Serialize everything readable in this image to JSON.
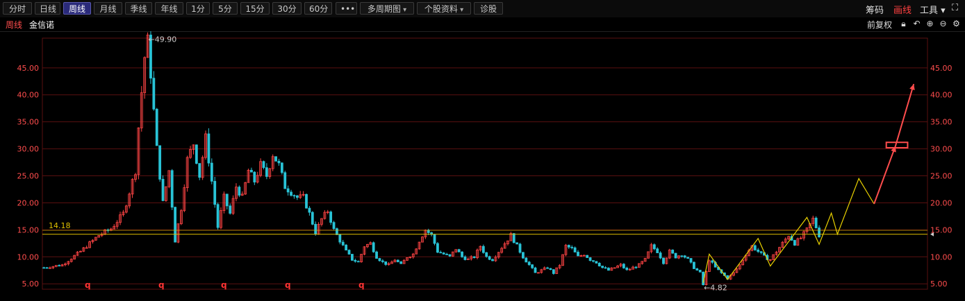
{
  "toolbar": {
    "buttons": [
      "分时",
      "日线",
      "周线",
      "月线",
      "季线",
      "年线",
      "1分",
      "5分",
      "15分",
      "30分",
      "60分",
      "•••",
      "多周期图",
      "个股资料",
      "诊股"
    ],
    "active_index": 2,
    "right_items": [
      "筹码",
      "画线",
      "工具"
    ]
  },
  "info": {
    "period": "周线",
    "stock_name": "金信诺",
    "adjust": "前复权"
  },
  "chart_data": {
    "type": "candlestick",
    "ylim": [
      4.0,
      50.5
    ],
    "y_ticks": [
      5.0,
      10.0,
      15.0,
      20.0,
      25.0,
      30.0,
      35.0,
      40.0,
      45.0
    ],
    "y_tick_labels": [
      "5.00",
      "10.00",
      "15.00",
      "20.00",
      "25.00",
      "30.00",
      "35.00",
      "40.00",
      "45.00"
    ],
    "high_label": "49.90",
    "low_label": "4.82",
    "level_label": "14.18",
    "level_value": 14.18,
    "level_value2": 14.9,
    "markers": [
      "q",
      "q",
      "q",
      "q",
      "q"
    ],
    "price_path": [
      [
        0,
        8.0
      ],
      [
        6,
        8.5
      ],
      [
        12,
        11
      ],
      [
        18,
        14
      ],
      [
        22,
        15.2
      ],
      [
        26,
        18
      ],
      [
        28,
        22
      ],
      [
        30,
        26
      ],
      [
        31,
        34
      ],
      [
        33,
        47
      ],
      [
        34,
        49.9
      ],
      [
        35,
        44
      ],
      [
        37,
        30
      ],
      [
        39,
        20
      ],
      [
        41,
        26
      ],
      [
        43,
        13
      ],
      [
        45,
        19
      ],
      [
        47,
        28
      ],
      [
        49,
        31
      ],
      [
        51,
        25
      ],
      [
        53,
        32
      ],
      [
        55,
        24
      ],
      [
        57,
        15.5
      ],
      [
        59,
        21
      ],
      [
        61,
        18
      ],
      [
        63,
        23
      ],
      [
        65,
        21
      ],
      [
        67,
        26
      ],
      [
        69,
        24
      ],
      [
        71,
        27
      ],
      [
        73,
        25
      ],
      [
        75,
        29
      ],
      [
        77,
        27
      ],
      [
        79,
        23
      ],
      [
        81,
        22
      ],
      [
        83,
        21
      ],
      [
        85,
        21
      ],
      [
        87,
        18
      ],
      [
        89,
        14.5
      ],
      [
        91,
        17
      ],
      [
        93,
        18.5
      ],
      [
        95,
        15
      ],
      [
        97,
        13
      ],
      [
        99,
        11
      ],
      [
        101,
        9.5
      ],
      [
        103,
        9
      ],
      [
        105,
        12
      ],
      [
        107,
        12.5
      ],
      [
        109,
        10
      ],
      [
        111,
        9
      ],
      [
        113,
        8.5
      ],
      [
        115,
        9.5
      ],
      [
        117,
        8.5
      ],
      [
        119,
        10
      ],
      [
        121,
        10.5
      ],
      [
        123,
        13
      ],
      [
        125,
        15
      ],
      [
        127,
        14
      ],
      [
        129,
        11
      ],
      [
        131,
        10.5
      ],
      [
        133,
        10
      ],
      [
        135,
        11.5
      ],
      [
        137,
        10
      ],
      [
        139,
        9.5
      ],
      [
        141,
        10
      ],
      [
        143,
        12
      ],
      [
        145,
        10
      ],
      [
        147,
        9.5
      ],
      [
        149,
        11
      ],
      [
        151,
        12.5
      ],
      [
        153,
        14
      ],
      [
        155,
        12
      ],
      [
        157,
        10
      ],
      [
        159,
        8.5
      ],
      [
        161,
        7
      ],
      [
        163,
        7.5
      ],
      [
        165,
        8
      ],
      [
        167,
        7
      ],
      [
        169,
        8.5
      ],
      [
        171,
        12
      ],
      [
        173,
        11.5
      ],
      [
        175,
        10
      ],
      [
        177,
        10.5
      ],
      [
        179,
        9.5
      ],
      [
        181,
        9
      ],
      [
        183,
        8
      ],
      [
        185,
        7.5
      ],
      [
        187,
        8
      ],
      [
        189,
        8.5
      ],
      [
        191,
        7.5
      ],
      [
        193,
        8
      ],
      [
        195,
        8.5
      ],
      [
        197,
        9.5
      ],
      [
        199,
        12
      ],
      [
        201,
        11
      ],
      [
        203,
        9
      ],
      [
        205,
        11
      ],
      [
        207,
        10
      ],
      [
        209,
        10.5
      ],
      [
        211,
        9.5
      ],
      [
        213,
        8
      ],
      [
        215,
        7
      ],
      [
        216,
        4.82
      ],
      [
        218,
        9.5
      ],
      [
        220,
        8
      ],
      [
        222,
        7
      ],
      [
        224,
        6
      ],
      [
        226,
        7
      ],
      [
        228,
        8.5
      ],
      [
        230,
        10.5
      ],
      [
        232,
        12
      ],
      [
        234,
        11
      ],
      [
        236,
        10
      ],
      [
        238,
        9.5
      ],
      [
        240,
        11
      ],
      [
        242,
        12.5
      ],
      [
        244,
        14
      ],
      [
        246,
        12.5
      ],
      [
        248,
        13.5
      ],
      [
        250,
        15
      ],
      [
        252,
        17
      ],
      [
        254,
        14
      ]
    ],
    "overlay_zigzag": [
      [
        216,
        5.2
      ],
      [
        218,
        10.5
      ],
      [
        224,
        5.8
      ],
      [
        234,
        13.4
      ],
      [
        238,
        8.3
      ],
      [
        250,
        17.3
      ],
      [
        254,
        12.3
      ],
      [
        258,
        18.1
      ],
      [
        260,
        14.2
      ],
      [
        267,
        24.5
      ],
      [
        272,
        19.8
      ]
    ],
    "arrow_path": [
      [
        272,
        19.8
      ],
      [
        279,
        30.5
      ],
      [
        285,
        42
      ]
    ],
    "target_box": [
      [
        276,
        30.2
      ],
      [
        283,
        31.2
      ]
    ]
  },
  "colors": {
    "up": "#ff4444",
    "down": "#29c3d6",
    "grid": "#5a1010",
    "level": "#e0c000",
    "zigzag": "#e8d000",
    "arrow": "#ff4d4d"
  }
}
